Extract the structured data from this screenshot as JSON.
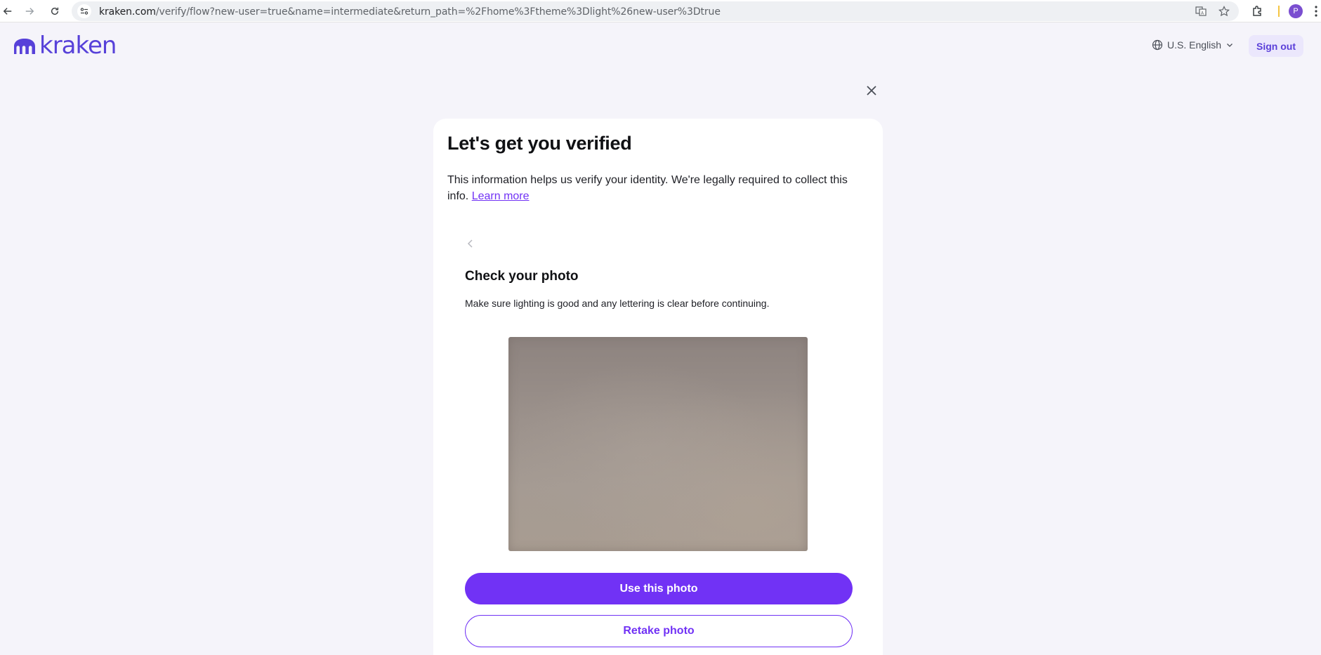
{
  "browser": {
    "url_host": "kraken.com",
    "url_path": "/verify/flow?new-user=true&name=intermediate&return_path=%2Fhome%3Ftheme%3Dlight%26new-user%3Dtrue",
    "profile_initial": "P",
    "icons": [
      "back-arrow-icon",
      "forward-arrow-icon",
      "reload-icon",
      "site-info-icon",
      "translate-icon",
      "star-icon",
      "extensions-icon",
      "menu-dots-icon"
    ]
  },
  "header": {
    "logo_text": "kraken",
    "language_label": "U.S. English",
    "sign_out_label": "Sign out"
  },
  "card": {
    "title": "Let's get you verified",
    "description": "This information helps us verify your identity. We're legally required to collect this info.",
    "learn_more_label": "Learn more",
    "step_title": "Check your photo",
    "step_description": "Make sure lighting is good and any lettering is clear before continuing.",
    "primary_button": "Use this photo",
    "secondary_button": "Retake photo"
  },
  "colors": {
    "brand_purple": "#7132f5",
    "logo_purple": "#5741d9",
    "page_background": "#f5f4fa"
  }
}
